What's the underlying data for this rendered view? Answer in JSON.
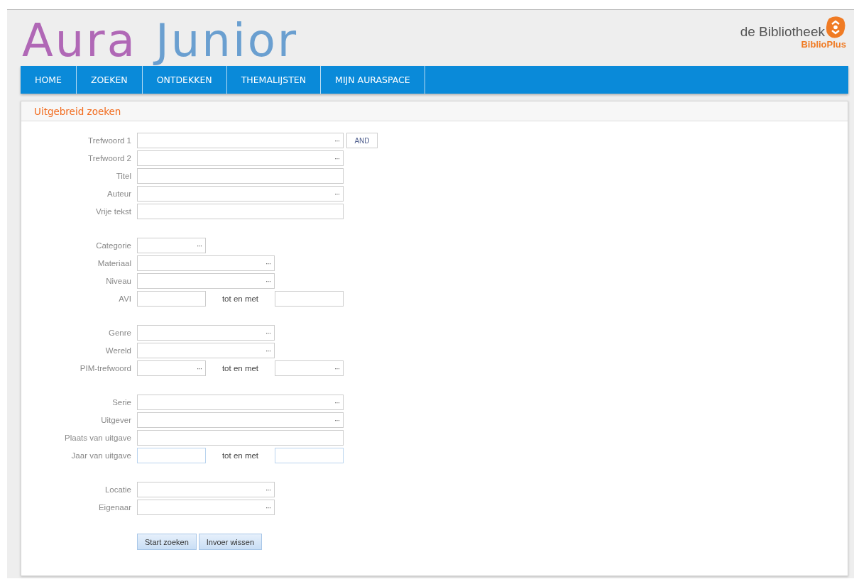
{
  "logo": {
    "parts": [
      {
        "text": "Aura",
        "color": "#b068b6"
      },
      {
        "text": "Junior",
        "color": "#6a9fd0"
      }
    ]
  },
  "library_logo": {
    "name": "de Bibliotheek",
    "branch": "BiblioPlus"
  },
  "nav": [
    {
      "label": "HOME"
    },
    {
      "label": "ZOEKEN"
    },
    {
      "label": "ONTDEKKEN"
    },
    {
      "label": "THEMALIJSTEN"
    },
    {
      "label": "MIJN AURASPACE"
    }
  ],
  "panel": {
    "title": "Uitgebreid zoeken",
    "groups": [
      {
        "rows": [
          {
            "label": "Trefwoord 1",
            "fields": [
              {
                "kind": "wide",
                "lookup": "···"
              }
            ],
            "action": "AND"
          },
          {
            "label": "Trefwoord 2",
            "fields": [
              {
                "kind": "wide",
                "lookup": "···"
              }
            ]
          },
          {
            "label": "Titel",
            "fields": [
              {
                "kind": "wide"
              }
            ]
          },
          {
            "label": "Auteur",
            "fields": [
              {
                "kind": "wide",
                "lookup": "···"
              }
            ]
          },
          {
            "label": "Vrije tekst",
            "fields": [
              {
                "kind": "wide"
              }
            ]
          }
        ]
      },
      {
        "rows": [
          {
            "label": "Categorie",
            "fields": [
              {
                "kind": "small",
                "lookup": "···"
              }
            ]
          },
          {
            "label": "Materiaal",
            "fields": [
              {
                "kind": "medium",
                "lookup": "···"
              }
            ]
          },
          {
            "label": "Niveau",
            "fields": [
              {
                "kind": "medium",
                "lookup": "···"
              }
            ]
          },
          {
            "label": "AVI",
            "fields": [
              {
                "kind": "small"
              },
              {
                "kind": "small"
              }
            ],
            "separator": "tot en met"
          }
        ]
      },
      {
        "rows": [
          {
            "label": "Genre",
            "fields": [
              {
                "kind": "medium",
                "lookup": "···"
              }
            ]
          },
          {
            "label": "Wereld",
            "fields": [
              {
                "kind": "medium",
                "lookup": "···"
              }
            ]
          },
          {
            "label": "PIM-trefwoord",
            "fields": [
              {
                "kind": "small",
                "lookup": "···"
              },
              {
                "kind": "small",
                "lookup": "···"
              }
            ],
            "separator": "tot en met"
          }
        ]
      },
      {
        "rows": [
          {
            "label": "Serie",
            "fields": [
              {
                "kind": "wide",
                "lookup": "···"
              }
            ]
          },
          {
            "label": "Uitgever",
            "fields": [
              {
                "kind": "wide",
                "lookup": "···"
              }
            ]
          },
          {
            "label": "Plaats van uitgave",
            "fields": [
              {
                "kind": "wide"
              }
            ]
          },
          {
            "label": "Jaar van uitgave",
            "fields": [
              {
                "kind": "small",
                "highlighted": true
              },
              {
                "kind": "small",
                "highlighted": true
              }
            ],
            "separator": "tot en met"
          }
        ]
      },
      {
        "rows": [
          {
            "label": "Locatie",
            "fields": [
              {
                "kind": "medium",
                "lookup": "···"
              }
            ]
          },
          {
            "label": "Eigenaar",
            "fields": [
              {
                "kind": "medium",
                "lookup": "···"
              }
            ]
          }
        ]
      }
    ],
    "buttons": [
      {
        "label": "Start zoeken"
      },
      {
        "label": "Invoer wissen"
      }
    ]
  }
}
